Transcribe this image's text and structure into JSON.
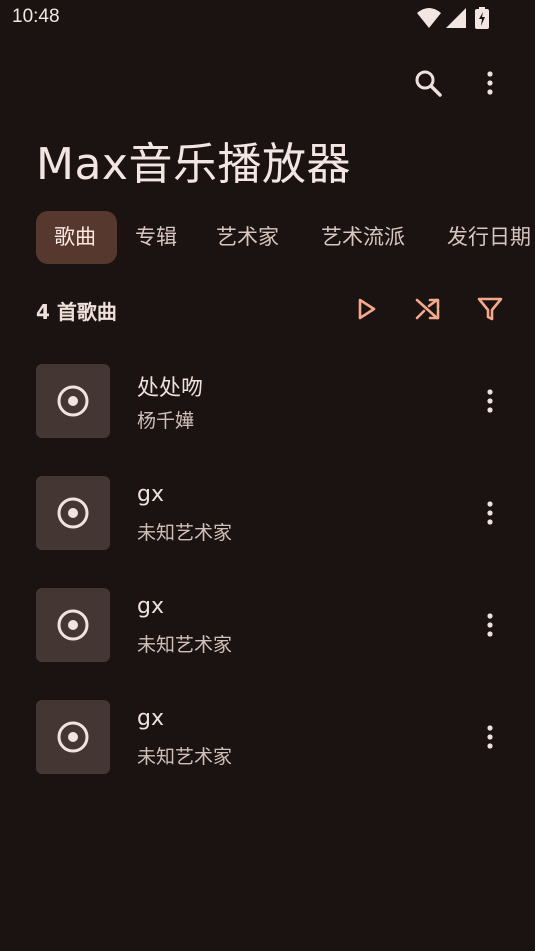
{
  "status": {
    "time": "10:48"
  },
  "app": {
    "title": "Max音乐播放器"
  },
  "tabs": [
    {
      "label": "歌曲",
      "active": true
    },
    {
      "label": "专辑",
      "active": false
    },
    {
      "label": "艺术家",
      "active": false
    },
    {
      "label": "艺术流派",
      "active": false
    },
    {
      "label": "发行日期",
      "active": false
    }
  ],
  "list": {
    "count_label": "4 首歌曲"
  },
  "songs": [
    {
      "title": "处处吻",
      "artist": "杨千嬅"
    },
    {
      "title": "gx",
      "artist": "未知艺术家"
    },
    {
      "title": "gx",
      "artist": "未知艺术家"
    },
    {
      "title": "gx",
      "artist": "未知艺术家"
    }
  ],
  "colors": {
    "background": "#1b1311",
    "accent": "#f4a98c",
    "active_tab": "#57382e",
    "cover": "#443733"
  },
  "icons": {
    "search": "search-icon",
    "more": "more-vert-icon",
    "play": "play-icon",
    "shuffle": "shuffle-icon",
    "filter": "filter-icon",
    "cover": "disc-icon"
  }
}
